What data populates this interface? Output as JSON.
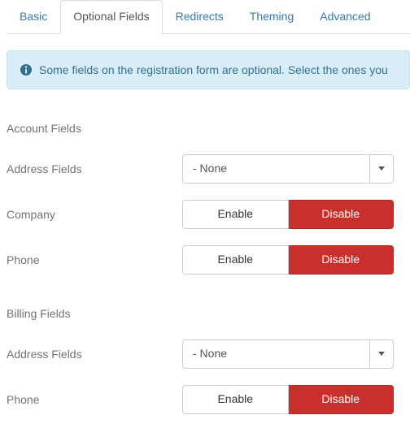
{
  "tabs": {
    "basic": "Basic",
    "optional": "Optional Fields",
    "redirects": "Redirects",
    "theming": "Theming",
    "advanced": "Advanced"
  },
  "alert": {
    "text": "Some fields on the registration form are optional. Select the ones you"
  },
  "headings": {
    "account": "Account Fields",
    "billing": "Billing Fields"
  },
  "labels": {
    "address_fields": "Address Fields",
    "company": "Company",
    "phone": "Phone"
  },
  "dropdown": {
    "none": "- None"
  },
  "buttons": {
    "enable": "Enable",
    "disable": "Disable"
  }
}
